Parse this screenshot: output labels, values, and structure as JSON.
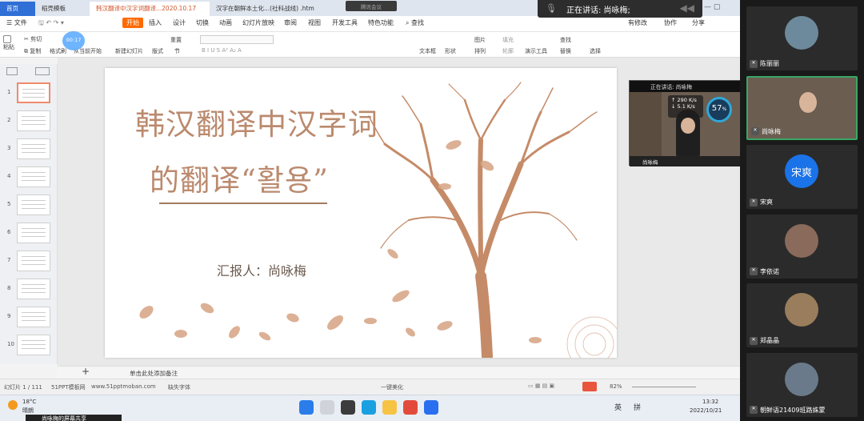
{
  "tabs": [
    {
      "label": "首页"
    },
    {
      "label": "稻壳模板"
    },
    {
      "label": "韩汉翻译中汉字词翻译...2020.10.17"
    },
    {
      "label": "汉字在朝鲜本土化...(社科战线) .htm"
    }
  ],
  "meeting_pill": "腾讯会议",
  "speaking": {
    "text": "正在讲话: 尚咏梅;"
  },
  "menu": {
    "file": "文件",
    "items": [
      "开始",
      "插入",
      "设计",
      "切换",
      "动画",
      "幻灯片放映",
      "审阅",
      "视图",
      "开发工具",
      "特色功能"
    ],
    "search": "查找",
    "right": [
      "有修改",
      "协作",
      "分享"
    ]
  },
  "ribbon": {
    "paste": "粘贴",
    "cut": "剪切",
    "copy": "复制",
    "format_painter": "格式刷",
    "from_current": "从当前开始",
    "new_slide": "新建幻灯片",
    "layout": "版式",
    "section": "节",
    "reset": "重置",
    "textbox": "文本框",
    "shape": "形状",
    "arrange": "排列",
    "picture": "图片",
    "fill": "填充",
    "outline": "轮廓",
    "present_tools": "演示工具",
    "find": "查找",
    "replace": "替换",
    "select": "选择",
    "circle_text": "00:17"
  },
  "thumbnails": [
    "1",
    "2",
    "3",
    "4",
    "5",
    "6",
    "7",
    "8",
    "9",
    "10"
  ],
  "slide": {
    "title_line1": "韩汉翻译中汉字词",
    "title_line2": "的翻译“활용”",
    "reporter": "汇报人：尚咏梅"
  },
  "notes_placeholder": "单击此处添加备注",
  "statusbar": {
    "slide_pos": "幻灯片 1 / 111",
    "template": "51PPT模板网",
    "site": "www.51pptmoban.com",
    "missing_font": "缺失字体",
    "beautify": "一键美化",
    "zoom": "82%"
  },
  "video_overlay": {
    "speaking": "正在讲话: 尚咏梅",
    "net_up": "290 K/s",
    "net_down": "5.1 K/s",
    "cpu": "57",
    "cpu_unit": "%",
    "name": "尚咏梅"
  },
  "taskbar": {
    "temp": "18°C",
    "weather": "晴朗",
    "ime1": "英",
    "ime2": "拼",
    "time": "13:32",
    "date": "2022/10/21"
  },
  "share_text": "尚咏梅的屏幕共享",
  "participants": [
    {
      "name": "陈丽丽",
      "avatar_color": "#6d8a9c"
    },
    {
      "name": "尚咏梅",
      "avatar_color": "#7b6a58"
    },
    {
      "name": "宋爽",
      "avatar_text": "宋爽",
      "avatar_color": "#1a73e8"
    },
    {
      "name": "李依诺",
      "avatar_color": "#8a6a5a"
    },
    {
      "name": "郑晶晶",
      "avatar_color": "#9a7d5c"
    },
    {
      "name": "朝鲜语21409班路姝蒙",
      "avatar_color": "#6a7a8a"
    }
  ],
  "colors": {
    "accent": "#ff6a00",
    "title": "#bb8a6e",
    "active_tile": "#3aa864"
  }
}
